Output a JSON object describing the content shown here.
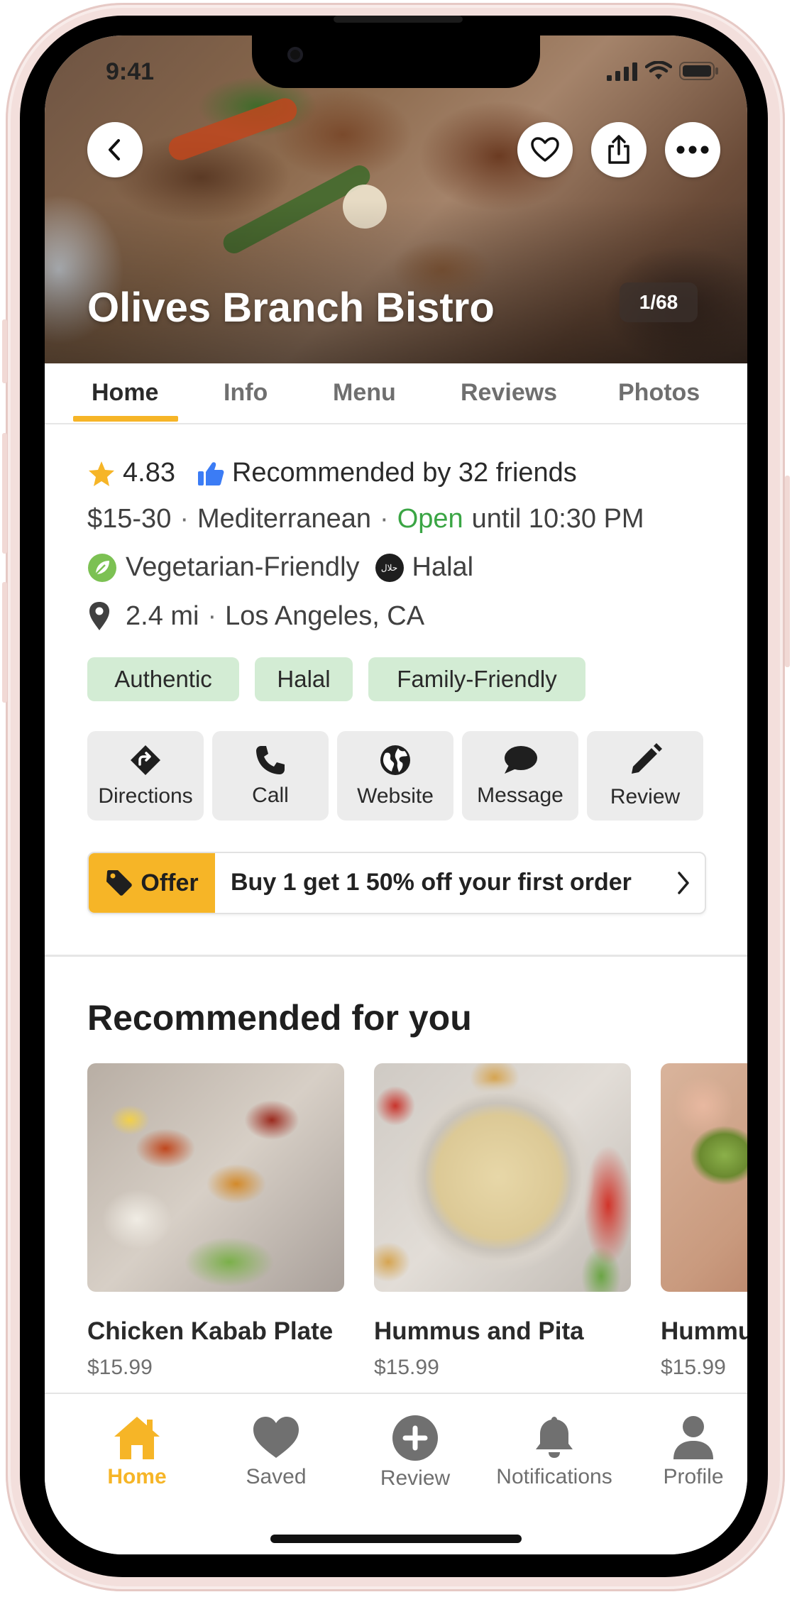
{
  "status_bar": {
    "time": "9:41"
  },
  "header": {
    "restaurant_name": "Olives Branch Bistro",
    "photo_counter": "1/68",
    "icons": [
      "back-icon",
      "heart-icon",
      "share-icon",
      "more-icon"
    ]
  },
  "tabs": [
    {
      "label": "Home",
      "active": true
    },
    {
      "label": "Info",
      "active": false
    },
    {
      "label": "Menu",
      "active": false
    },
    {
      "label": "Reviews",
      "active": false
    },
    {
      "label": "Photos",
      "active": false
    }
  ],
  "summary": {
    "rating": "4.83",
    "recommended": "Recommended by 32 friends",
    "price_range": "$15-30",
    "cuisine": "Mediterranean",
    "open_status": "Open",
    "hours": "until 10:30 PM",
    "diet_1": "Vegetarian-Friendly",
    "diet_2": "Halal",
    "halal_badge": "حلال",
    "distance": "2.4 mi",
    "location": "Los Angeles, CA"
  },
  "tags": [
    "Authentic",
    "Halal",
    "Family-Friendly"
  ],
  "actions": [
    {
      "label": "Directions",
      "icon": "directions-icon"
    },
    {
      "label": "Call",
      "icon": "phone-icon"
    },
    {
      "label": "Website",
      "icon": "globe-icon"
    },
    {
      "label": "Message",
      "icon": "message-icon"
    },
    {
      "label": "Review",
      "icon": "pencil-icon"
    }
  ],
  "offer": {
    "badge": "Offer",
    "text": "Buy 1 get 1 50% off your first order"
  },
  "recommended": {
    "title": "Recommended for you",
    "items": [
      {
        "name": "Chicken Kabab Plate",
        "price": "$15.99"
      },
      {
        "name": "Hummus and Pita",
        "price": "$15.99"
      },
      {
        "name": "Hummus",
        "price": "$15.99"
      }
    ]
  },
  "bottom_nav": [
    {
      "label": "Home",
      "active": true
    },
    {
      "label": "Saved",
      "active": false
    },
    {
      "label": "Review",
      "active": false
    },
    {
      "label": "Notifications",
      "active": false
    },
    {
      "label": "Profile",
      "active": false
    }
  ],
  "colors": {
    "accent": "#f6b527",
    "open_green": "#3aa544",
    "tag_bg": "#d3ecd4",
    "like_blue": "#3b7cf5"
  }
}
